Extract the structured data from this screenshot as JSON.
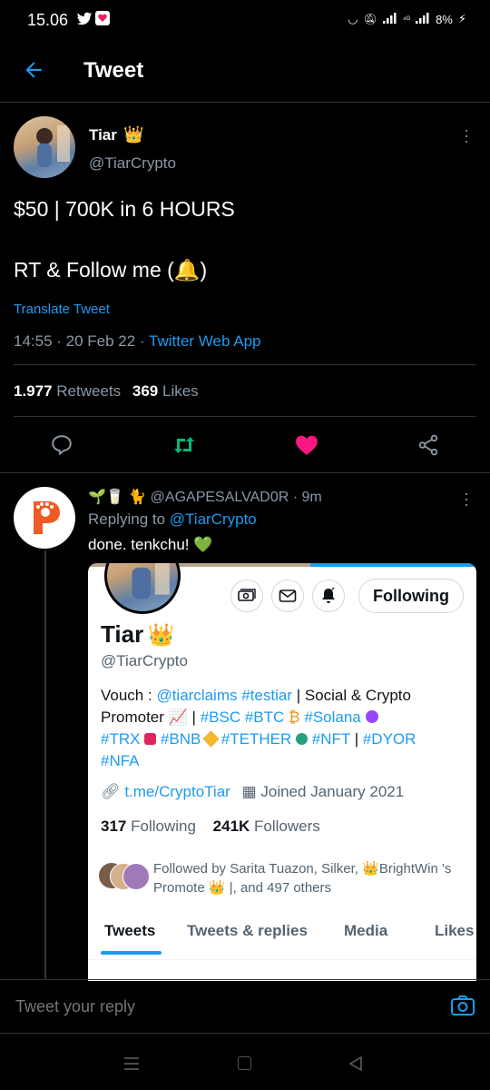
{
  "status": {
    "time": "15.06",
    "right_text": "8%"
  },
  "header": {
    "title": "Tweet"
  },
  "tweet": {
    "author_name": "Tiar",
    "author_handle": "@TiarCrypto",
    "line1": "$50 | 700K in 6 HOURS",
    "line2_a": "RT & Follow me (",
    "line2_b": ")",
    "translate": "Translate Tweet",
    "time": "14:55 · 20 Feb 22 · ",
    "source": "Twitter Web App",
    "retweets_count": "1.977",
    "retweets_label": "Retweets",
    "likes_count": "369",
    "likes_label": "Likes"
  },
  "reply": {
    "handle": "@AGAPESALVAD0R",
    "time": " · 9m",
    "replying_prefix": "Replying to ",
    "replying_to": "@TiarCrypto",
    "text": "done. tenkchu! "
  },
  "card": {
    "name": "Tiar",
    "handle": "@TiarCrypto",
    "following_btn": "Following",
    "bio_prefix": "Vouch : ",
    "bio_l1_a": "@tiarclaims",
    "bio_l1_b": "#testiar",
    "bio_l1_c": " | Social & Crypto",
    "bio_l2_a": "Promoter ",
    "bio_l2_b": " | ",
    "bio_l2_bsc": "#BSC",
    "bio_l2_btc": "#BTC",
    "bio_l2_sol": "#Solana",
    "bio_l3_trx": "#TRX",
    "bio_l3_bnb": "#BNB",
    "bio_l3_tether": "#TETHER",
    "bio_l3_nft": "#NFT",
    "bio_l3_sep": " | ",
    "bio_l3_dyor": "#DYOR",
    "bio_l4": "#NFA",
    "link": "t.me/CryptoTiar",
    "joined": "Joined January 2021",
    "following_count": "317",
    "following_label": "Following",
    "followers_count": "241K",
    "followers_label": "Followers",
    "followed_l1": "Followed by Sarita Tuazon, Silker, ",
    "followed_l1b": "BrightWin 's",
    "followed_l2a": "Promote ",
    "followed_l2b": " |, and 497 others",
    "tabs": [
      "Tweets",
      "Tweets & replies",
      "Media",
      "Likes"
    ]
  },
  "reply_bar": {
    "placeholder": "Tweet your reply"
  }
}
